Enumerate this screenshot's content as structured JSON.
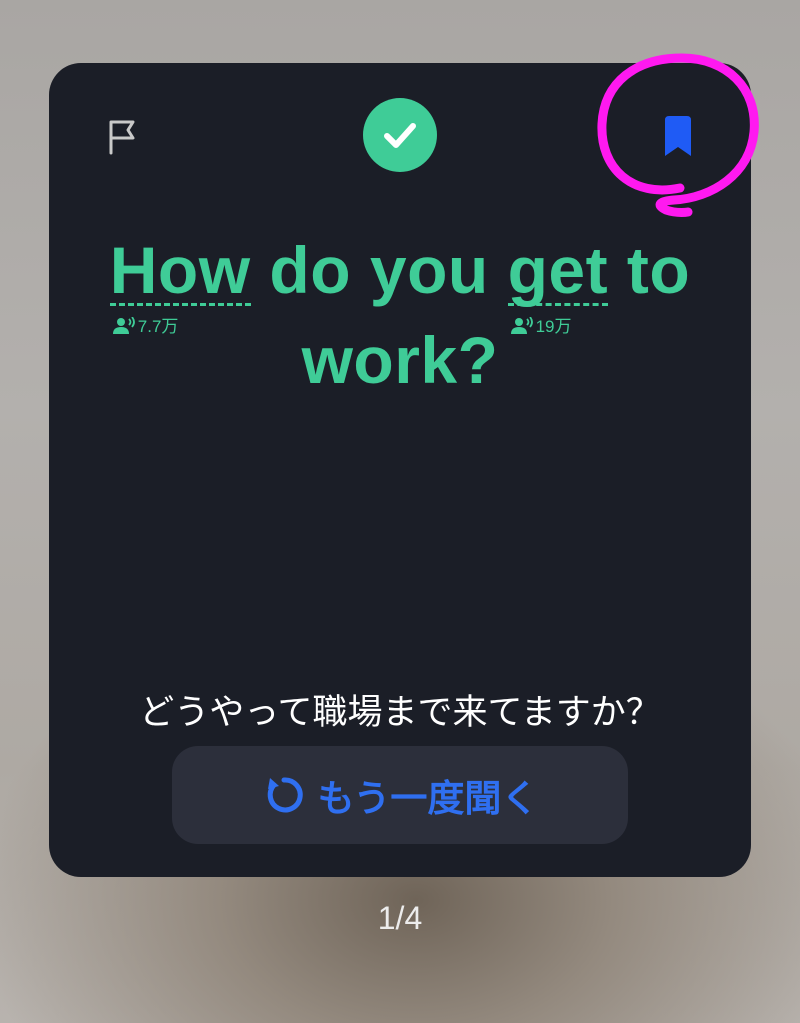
{
  "card": {
    "sentence": {
      "line1": {
        "w1": "How",
        "w2": " do you ",
        "w3": "get",
        "w4": " to"
      },
      "line2": "work?",
      "tagged_words": [
        {
          "word": "How",
          "frequency": "7.7万"
        },
        {
          "word": "get",
          "frequency": "19万"
        }
      ]
    },
    "translation": "どうやって職場まで来てますか？",
    "replay_button": {
      "label": "もう一度聞く"
    }
  },
  "icons": {
    "flag": "flag-icon",
    "check": "check-icon",
    "bookmark": "bookmark-icon",
    "replay": "replay-icon",
    "listeners": "listeners-icon"
  },
  "colors": {
    "card_background": "#1b1e27",
    "accent_green": "#3fcc97",
    "bookmark_blue": "#1f5bf5",
    "replay_blue": "#2f6ff0",
    "annotation_magenta": "#ff19f0"
  },
  "pager": {
    "current": "1/4"
  }
}
